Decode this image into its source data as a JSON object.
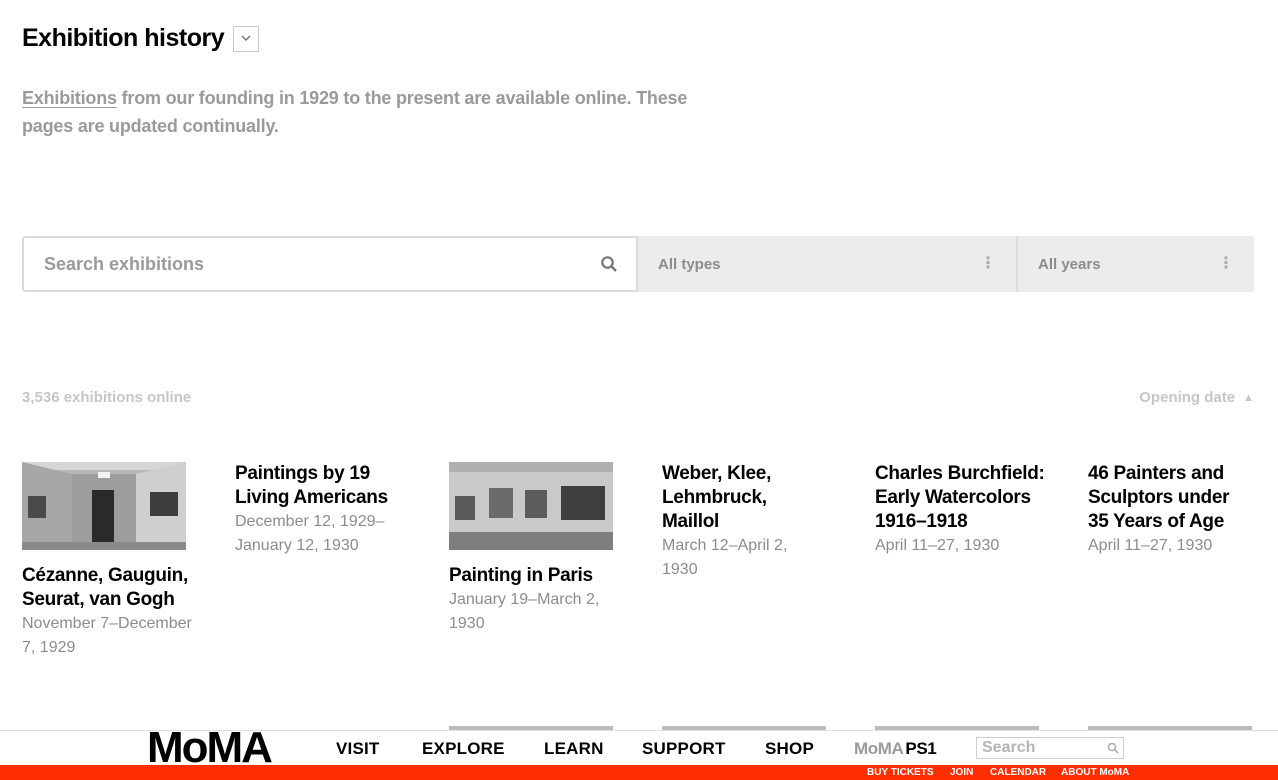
{
  "header": {
    "title": "Exhibition history",
    "toggle_icon": "chevron-down-icon"
  },
  "intro": {
    "link_text": "Exhibitions",
    "text": " from our founding in 1929 to the present are available online. These pages are updated continually."
  },
  "filters": {
    "search_placeholder": "Search exhibitions",
    "type_label": "All types",
    "year_label": "All years",
    "menu_icon": "⋮"
  },
  "results": {
    "count_label": "3,536 exhibitions online",
    "sort_label": "Opening date",
    "sort_direction_icon": "▲"
  },
  "exhibitions": [
    {
      "title": "Cézanne, Gauguin, Seurat, van Gogh",
      "date": "November 7–December 7, 1929",
      "has_image": true
    },
    {
      "title": "Paintings by 19 Living Americans",
      "date": "December 12, 1929–January 12, 1930",
      "has_image": false
    },
    {
      "title": "Painting in Paris",
      "date": "January 19–March 2, 1930",
      "has_image": true
    },
    {
      "title": "Weber, Klee, Lehmbruck, Maillol",
      "date": "March 12–April 2, 1930",
      "has_image": false
    },
    {
      "title": "Charles Burchfield: Early Watercolors 1916–1918",
      "date": "April 11–27, 1930",
      "has_image": false
    },
    {
      "title": "46 Painters and Sculptors under 35 Years of Age",
      "date": "April 11–27, 1930",
      "has_image": false
    }
  ],
  "footer": {
    "logo": "MoMA",
    "nav": [
      "VISIT",
      "EXPLORE",
      "LEARN",
      "SUPPORT",
      "SHOP"
    ],
    "ps1_moma": "MoMA",
    "ps1_ps1": "PS1",
    "search_placeholder": "Search",
    "utility_links": [
      "BUY TICKETS",
      "JOIN",
      "CALENDAR",
      "ABOUT MoMA"
    ],
    "accent_color": "#ff2e00"
  }
}
